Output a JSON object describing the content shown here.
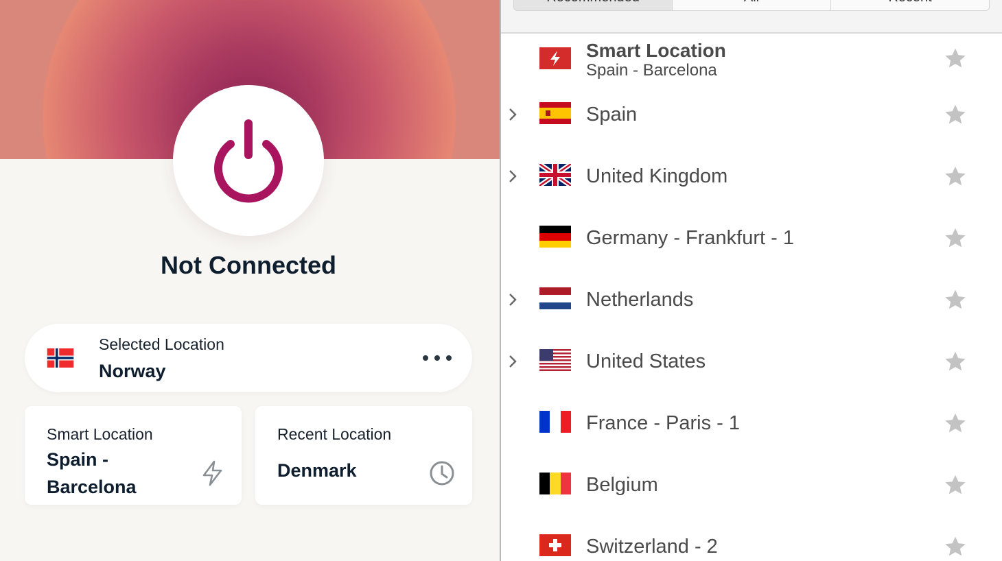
{
  "colors": {
    "accent": "#a8155e",
    "hero_outer": "#f3a677",
    "hero_inner": "#8e2456",
    "star": "#c3c3c3"
  },
  "status": "Not Connected",
  "selected_location": {
    "label": "Selected Location",
    "value": "Norway",
    "flag": "norway"
  },
  "smart_location_card": {
    "label": "Smart Location",
    "value": "Spain - Barcelona",
    "icon": "lightning-icon"
  },
  "recent_location_card": {
    "label": "Recent Location",
    "value": "Denmark",
    "icon": "clock-icon"
  },
  "tabs": [
    {
      "label": "Recommended",
      "active": true
    },
    {
      "label": "All",
      "active": false
    },
    {
      "label": "Recent",
      "active": false
    }
  ],
  "smart_location_row": {
    "title": "Smart Location",
    "subtitle": "Spain - Barcelona",
    "icon": "smart-location-icon"
  },
  "locations": [
    {
      "name": "Spain",
      "flag": "spain",
      "expandable": true
    },
    {
      "name": "United Kingdom",
      "flag": "uk",
      "expandable": true
    },
    {
      "name": "Germany - Frankfurt - 1",
      "flag": "germany",
      "expandable": false
    },
    {
      "name": "Netherlands",
      "flag": "netherlands",
      "expandable": true
    },
    {
      "name": "United States",
      "flag": "usa",
      "expandable": true
    },
    {
      "name": "France - Paris - 1",
      "flag": "france",
      "expandable": false
    },
    {
      "name": "Belgium",
      "flag": "belgium",
      "expandable": false
    },
    {
      "name": "Switzerland - 2",
      "flag": "switzerland",
      "expandable": false
    }
  ]
}
